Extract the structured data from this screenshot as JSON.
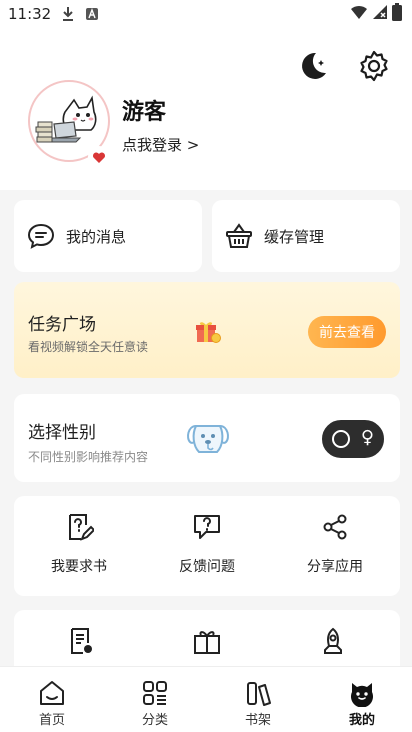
{
  "status_bar": {
    "time": "11:32"
  },
  "profile": {
    "username": "游客",
    "login_link": "点我登录 >"
  },
  "quick_actions": [
    {
      "label": "我的消息",
      "icon": "chat-bubble-icon"
    },
    {
      "label": "缓存管理",
      "icon": "basket-icon"
    }
  ],
  "task_center": {
    "title": "任务广场",
    "subtitle": "看视频解锁全天任意读",
    "button_label": "前去查看",
    "accent": "#ff9a2e"
  },
  "gender": {
    "title": "选择性别",
    "subtitle": "不同性别影响推荐内容",
    "toggle_symbol": "♀"
  },
  "tools": [
    {
      "label": "我要求书",
      "icon": "request-book-icon"
    },
    {
      "label": "反馈问题",
      "icon": "feedback-icon"
    },
    {
      "label": "分享应用",
      "icon": "share-icon"
    }
  ],
  "bottom_nav": [
    {
      "label": "首页",
      "icon": "home-icon"
    },
    {
      "label": "分类",
      "icon": "category-icon"
    },
    {
      "label": "书架",
      "icon": "bookshelf-icon"
    },
    {
      "label": "我的",
      "icon": "profile-face-icon",
      "active": true
    }
  ]
}
